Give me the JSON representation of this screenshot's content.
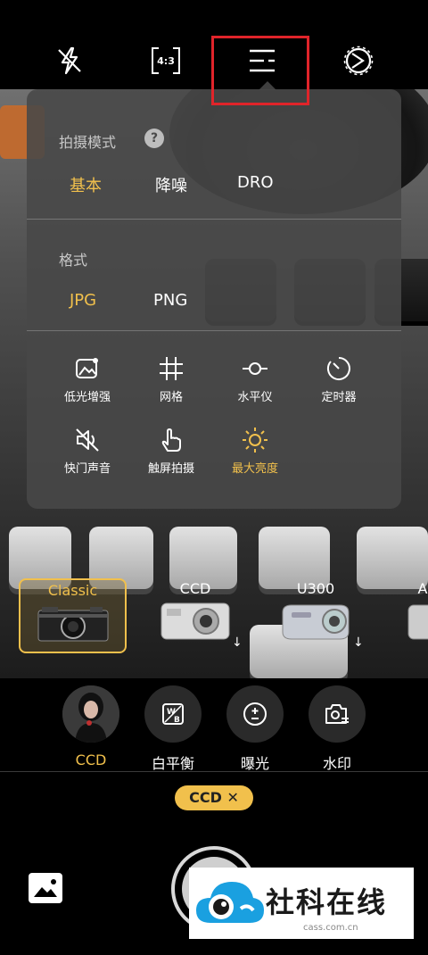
{
  "topbar": {
    "flash_icon": "flash-off-icon",
    "ratio_label": "4:3",
    "menu_icon": "menu-icon",
    "settings_icon": "settings-icon"
  },
  "panel": {
    "shoot_mode_title": "拍摄模式",
    "help_label": "?",
    "modes": [
      {
        "label": "基本",
        "selected": true
      },
      {
        "label": "降噪",
        "selected": false
      },
      {
        "label": "DRO",
        "selected": false
      }
    ],
    "format_title": "格式",
    "formats": [
      {
        "label": "JPG",
        "selected": true
      },
      {
        "label": "PNG",
        "selected": false
      }
    ],
    "tools": [
      {
        "label": "低光增强",
        "icon": "low-light-icon",
        "selected": false
      },
      {
        "label": "网格",
        "icon": "grid-icon",
        "selected": false
      },
      {
        "label": "水平仪",
        "icon": "level-icon",
        "selected": false
      },
      {
        "label": "定时器",
        "icon": "timer-icon",
        "selected": false
      },
      {
        "label": "快门声音",
        "icon": "shutter-sound-off-icon",
        "selected": false
      },
      {
        "label": "触屏拍摄",
        "icon": "touch-shoot-icon",
        "selected": false
      },
      {
        "label": "最大亮度",
        "icon": "brightness-icon",
        "selected": true
      }
    ]
  },
  "filters": [
    {
      "label": "Classic",
      "selected": true
    },
    {
      "label": "CCD",
      "selected": false
    },
    {
      "label": "U300",
      "selected": false
    },
    {
      "label": "A",
      "selected": false
    }
  ],
  "download_arrow": "↓",
  "bottom": {
    "buttons": [
      {
        "label": "CCD",
        "icon": "portrait-thumbnail",
        "selected": true
      },
      {
        "label": "白平衡",
        "icon": "white-balance-icon",
        "selected": false
      },
      {
        "label": "曝光",
        "icon": "exposure-icon",
        "selected": false
      },
      {
        "label": "水印",
        "icon": "watermark-camera-icon",
        "selected": false
      }
    ],
    "chip_label": "CCD ✕"
  },
  "watermark": {
    "text": "社科在线",
    "url": "cass.com.cn"
  },
  "colors": {
    "accent": "#f1c04c",
    "highlight_box": "#e0242a",
    "panel_bg": "#484848"
  }
}
